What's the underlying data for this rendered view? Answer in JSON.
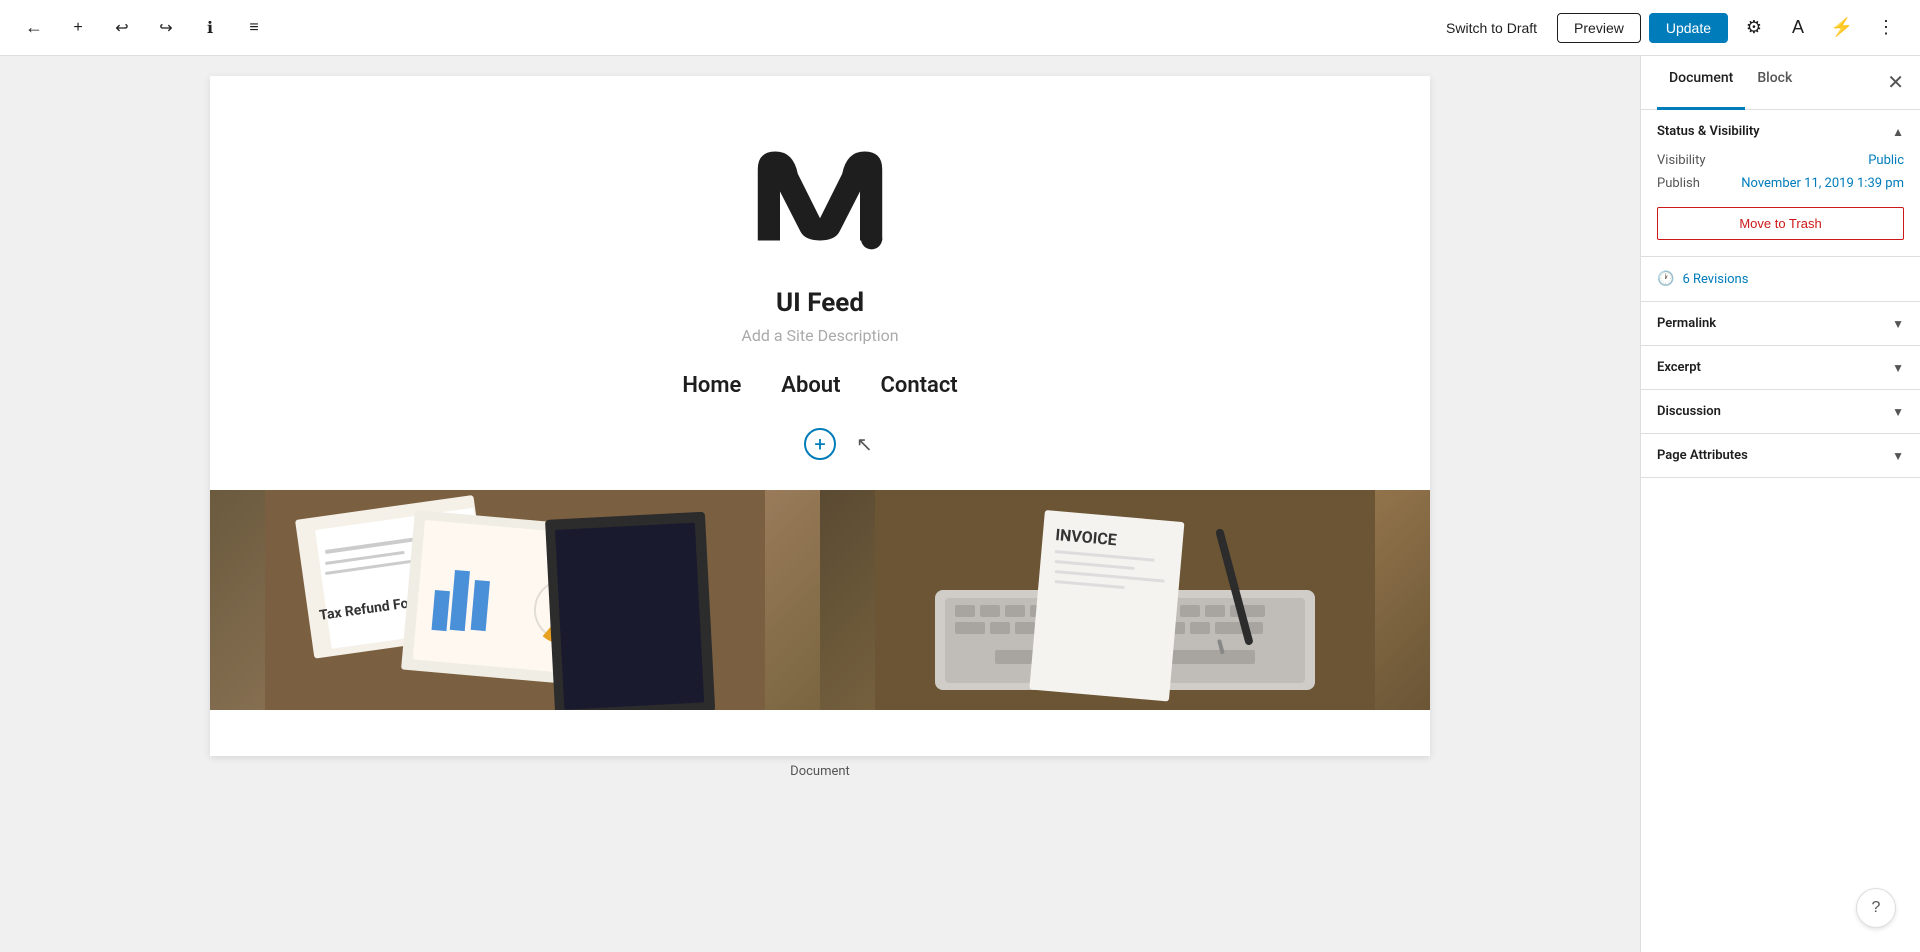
{
  "toolbar": {
    "back_icon": "←",
    "add_icon": "+",
    "undo_icon": "↩",
    "redo_icon": "↪",
    "info_icon": "ℹ",
    "list_icon": "≡",
    "switch_to_draft_label": "Switch to Draft",
    "preview_label": "Preview",
    "update_label": "Update",
    "gear_icon": "⚙",
    "a_icon": "A",
    "bolt_icon": "⚡",
    "more_icon": "⋮"
  },
  "canvas": {
    "site_title": "UI Feed",
    "site_description": "Add a Site Description",
    "nav_items": [
      {
        "label": "Home"
      },
      {
        "label": "About"
      },
      {
        "label": "Contact"
      }
    ]
  },
  "sidebar": {
    "tab_document_label": "Document",
    "tab_block_label": "Block",
    "sections": {
      "status_visibility": {
        "title": "Status & Visibility",
        "visibility_label": "Visibility",
        "visibility_value": "Public",
        "publish_label": "Publish",
        "publish_value": "November 11, 2019 1:39 pm",
        "move_to_trash_label": "Move to Trash"
      },
      "revisions": {
        "count": "6",
        "label": "6 Revisions"
      },
      "permalink": {
        "title": "Permalink"
      },
      "excerpt": {
        "title": "Excerpt"
      },
      "discussion": {
        "title": "Discussion"
      },
      "page_attributes": {
        "title": "Page Attributes"
      }
    }
  },
  "footer": {
    "document_label": "Document"
  },
  "help_icon": "?"
}
